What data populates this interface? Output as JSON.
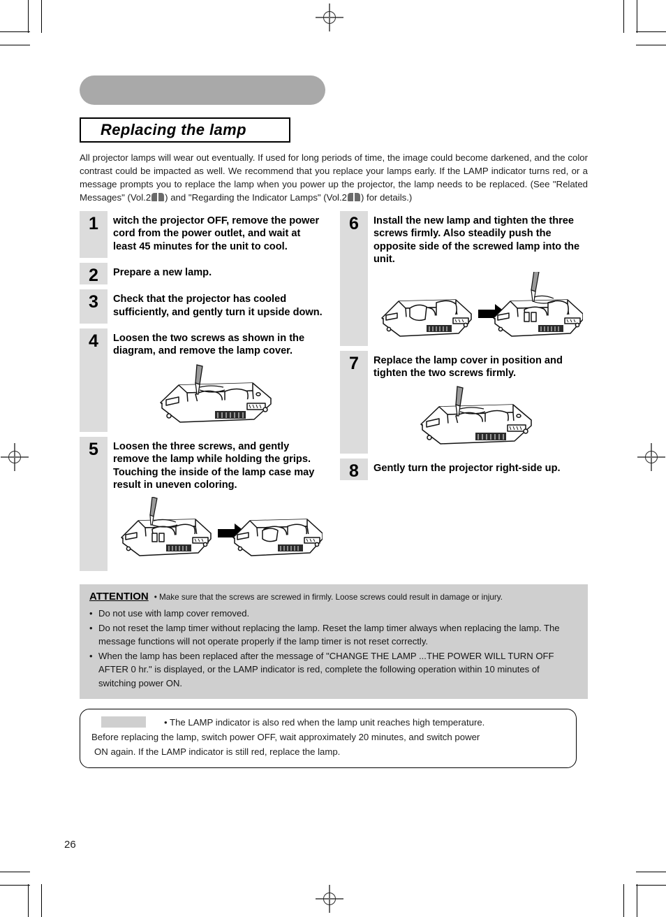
{
  "page": {
    "number": "26",
    "section_title": "Replacing the lamp"
  },
  "intro": {
    "part1": "All projector lamps will wear out eventually. If used for long periods of time, the image could become darkened, and the color contrast could be impacted as well. We recommend that you replace your lamps early. If the LAMP indicator turns red, or a message prompts you to replace the lamp when you power up the projector, the lamp needs to be replaced. (See \"Related Messages\" (Vol.2",
    "part2": ") and \"Regarding the Indicator Lamps\" (Vol.2",
    "part3": ") for details.)"
  },
  "steps_left": [
    {
      "number": "1",
      "text": "witch the projector OFF, remove the power cord from the power outlet, and wait at least 45 minutes for the unit to cool.",
      "has_figure": false
    },
    {
      "number": "2",
      "text": "Prepare a new lamp.",
      "has_figure": false
    },
    {
      "number": "3",
      "text": "Check that the projector has cooled sufficiently, and gently turn it upside down.",
      "has_figure": false
    },
    {
      "number": "4",
      "text": "Loosen the two screws as shown in the diagram, and remove the lamp cover.",
      "has_figure": true,
      "figure": "projector-lamp-cover-screws"
    },
    {
      "number": "5",
      "text": "Loosen the three screws, and gently remove the lamp while holding the grips. Touching the inside of the lamp case may result in uneven coloring.",
      "has_figure": true,
      "figure": "projector-remove-lamp-sequence"
    }
  ],
  "steps_right": [
    {
      "number": "6",
      "text": "Install the new lamp and tighten the three screws firmly. Also steadily push the opposite side of the screwed lamp into the unit.",
      "has_figure": true,
      "figure": "projector-install-lamp-sequence"
    },
    {
      "number": "7",
      "text": "Replace the lamp cover in position and tighten the two screws firmly.",
      "has_figure": true,
      "figure": "projector-replace-cover-screws"
    },
    {
      "number": "8",
      "text": "Gently turn the projector right-side up.",
      "has_figure": false
    }
  ],
  "attention": {
    "heading": "ATTENTION",
    "lead": "• Make sure that the screws are screwed in firmly. Loose screws could result in damage or injury.",
    "items": [
      "Do not use with lamp cover removed.",
      "Do not reset the lamp timer without replacing the lamp. Reset the lamp timer always when replacing the lamp. The message functions will not operate  properly if the lamp timer is not reset correctly.",
      "When the lamp has been replaced after the message of \"CHANGE THE LAMP ...THE POWER WILL TURN OFF AFTER 0 hr.\" is displayed, or the LAMP indicator is red, complete the following operation within 10 minutes of switching power ON."
    ]
  },
  "note": {
    "line1": "• The LAMP indicator is also red when the lamp unit reaches high temperature.",
    "line2": "Before replacing the lamp, switch power OFF, wait approximately 20 minutes, and switch power",
    "line3": "ON again. If the LAMP indicator is still red, replace the lamp."
  },
  "colors": {
    "header_bar": "#a9a9a9",
    "step_block": "#e2e2e2",
    "step_number_col": "#dcdcdc",
    "attention_bg": "#cfcfcf",
    "text": "#1d1d1d"
  }
}
